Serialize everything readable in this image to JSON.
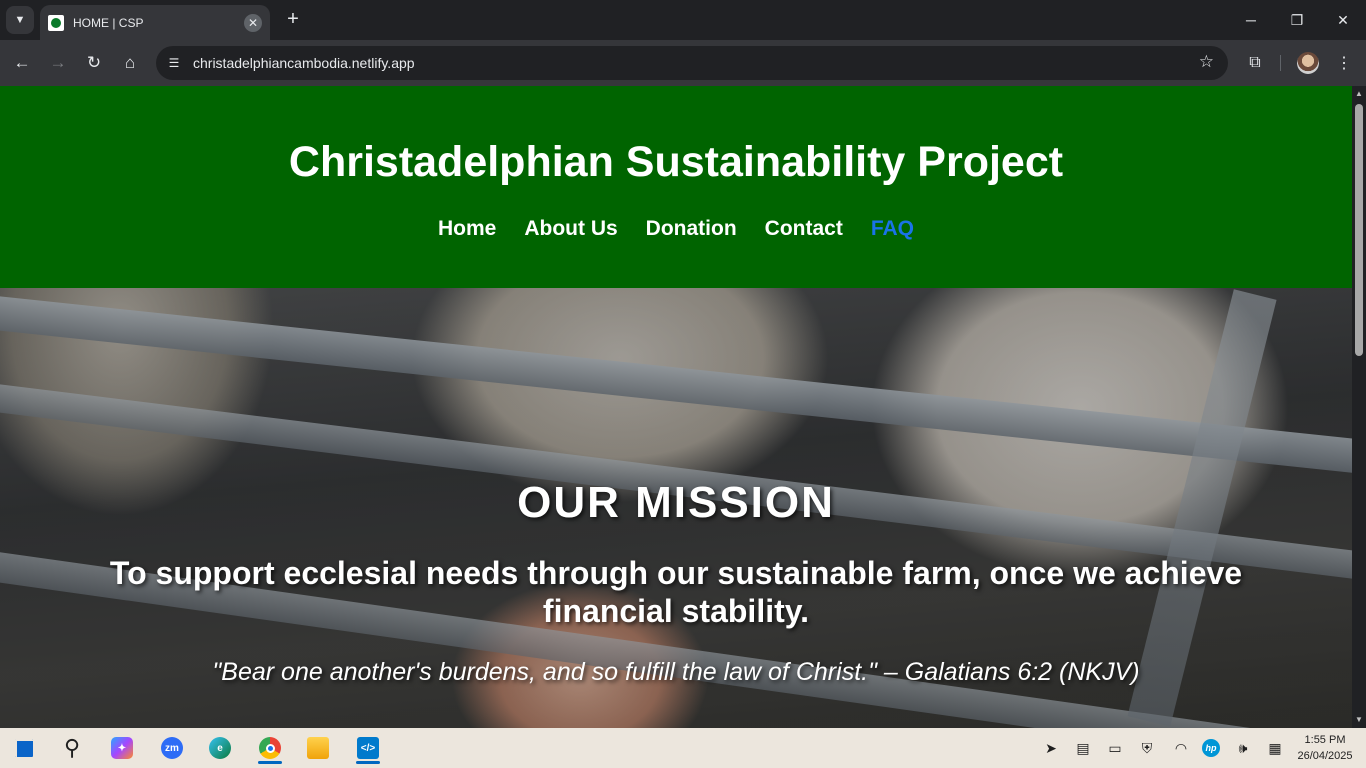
{
  "browser": {
    "tab_title": "HOME | CSP",
    "url": "christadelphiancambodia.netlify.app",
    "new_tab_symbol": "+",
    "icons": [
      "tab-search-icon",
      "close-icon",
      "back-icon",
      "forward-icon",
      "reload-icon",
      "home-icon",
      "site-info-icon",
      "bookmark-star-icon",
      "extensions-icon",
      "profile-avatar",
      "more-menu-icon",
      "minimize-icon",
      "restore-icon",
      "window-close-icon"
    ]
  },
  "site": {
    "title": "Christadelphian Sustainability Project",
    "nav": {
      "home": "Home",
      "about": "About Us",
      "donation": "Donation",
      "contact": "Contact",
      "faq": "FAQ"
    },
    "active_nav_color": "#1a73e8",
    "header_color": "#006400"
  },
  "hero": {
    "heading": "OUR MISSION",
    "mission": "To support ecclesial needs through our sustainable farm, once we achieve financial stability.",
    "verse": "\"Bear one another's burdens, and so fulfill the law of Christ.\" – Galatians 6:2 (NKJV)"
  },
  "taskbar": {
    "apps": [
      "windows-start-icon",
      "search-icon",
      "copilot-icon",
      "zoom-icon",
      "edge-icon",
      "chrome-icon",
      "file-explorer-icon",
      "vscode-icon"
    ],
    "time": "1:55 PM",
    "date": "26/04/2025"
  }
}
